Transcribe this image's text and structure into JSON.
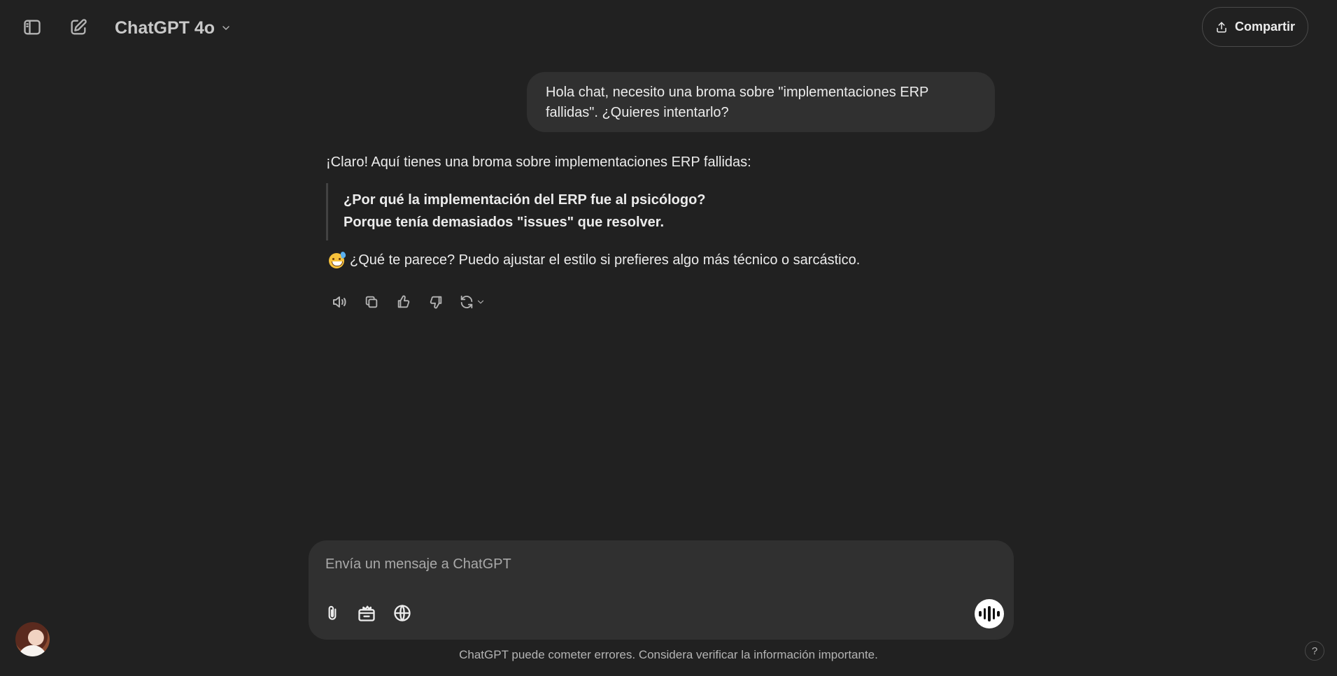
{
  "header": {
    "model_name": "ChatGPT 4o",
    "share_label": "Compartir"
  },
  "conversation": {
    "user_message": "Hola chat, necesito una broma sobre \"implementaciones ERP fallidas\". ¿Quieres intentarlo?",
    "assistant": {
      "intro": "¡Claro! Aquí tienes una broma sobre implementaciones ERP fallidas:",
      "quote_line_1": "¿Por qué la implementación del ERP fue al psicólogo?",
      "quote_line_2": "Porque tenía demasiados \"issues\" que resolver.",
      "followup": "¿Qué te parece? Puedo ajustar el estilo si prefieres algo más técnico o sarcástico.",
      "emoji": "grinning-face-with-sweat"
    },
    "action_icons": [
      "speaker-icon",
      "copy-icon",
      "thumbs-up-icon",
      "thumbs-down-icon",
      "regenerate-icon"
    ]
  },
  "composer": {
    "placeholder": "Envía un mensaje a ChatGPT",
    "tool_icons": [
      "paperclip-icon",
      "toolbox-icon",
      "globe-icon"
    ],
    "voice_icon": "voice-waveform-icon"
  },
  "footer": {
    "disclaimer": "ChatGPT puede cometer errores. Considera verificar la información importante.",
    "help_label": "?"
  }
}
